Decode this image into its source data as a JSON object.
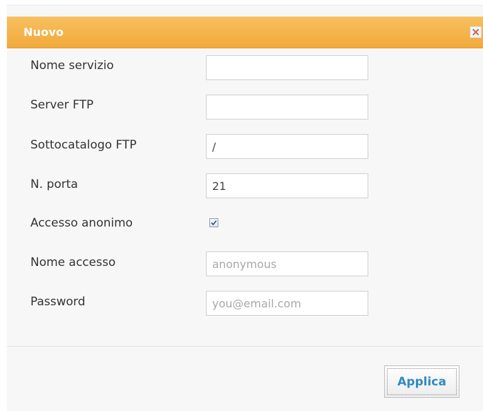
{
  "dialog": {
    "title": "Nuovo",
    "close_icon": "close-icon"
  },
  "form": {
    "service_name": {
      "label": "Nome servizio",
      "value": ""
    },
    "ftp_server": {
      "label": "Server FTP",
      "value": ""
    },
    "ftp_subdir": {
      "label": "Sottocatalogo FTP",
      "value": "/"
    },
    "port": {
      "label": "N. porta",
      "value": "21"
    },
    "anonymous": {
      "label": "Accesso anonimo",
      "checked": true
    },
    "login_name": {
      "label": "Nome accesso",
      "placeholder": "anonymous"
    },
    "password": {
      "label": "Password",
      "placeholder": "you@email.com"
    }
  },
  "footer": {
    "apply_label": "Applica"
  },
  "colors": {
    "titlebar": "#f2a93a",
    "title_text": "#ffffff",
    "button_text": "#2e8bc0"
  }
}
